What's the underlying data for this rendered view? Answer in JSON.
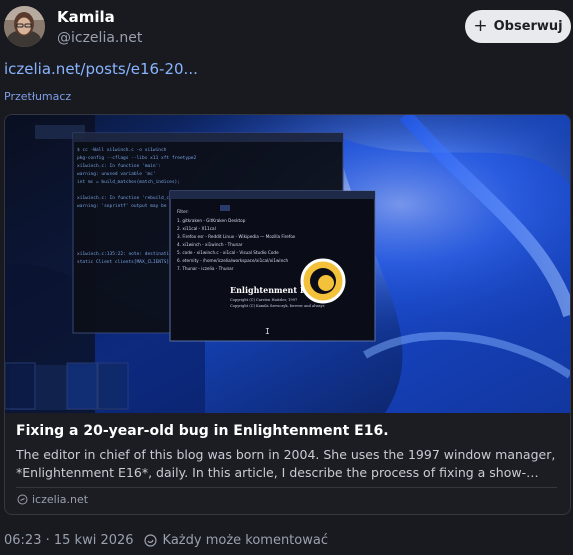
{
  "author": {
    "display_name": "Kamila",
    "handle": "@iczelia.net"
  },
  "actions": {
    "follow_label": "Obserwuj"
  },
  "post": {
    "link_text": "iczelia.net/posts/e16-20...",
    "translate_label": "Przetłumacz"
  },
  "link_card": {
    "title": "Fixing a 20-year-old bug in Enlightenment E16.",
    "description": "The editor in chief of this blog was born in 2004. She uses the 1997 window manager, *Enlightenment E16*, daily. In this article, I describe the process of fixing a show-…",
    "domain": "iczelia.net",
    "image": {
      "caption_title": "Enlightenment E16",
      "caption_lines": [
        "Copyright (C) Carsten Haitzler, 1997",
        "Copyright (C) Kamila Szewczyk, forever and always"
      ],
      "menu_items": [
        "1. gitkraken - GitKraken Desktop",
        "2. xi11cal - X11cal",
        "3. Firefox esr - Reddit Linux - Wikipedia — Mozilla Firefox",
        "4. xi1winch - xi1winch - Thunar",
        "5. code - xi1winch.c - xi1cal - Visual Studio Code",
        "6. eternity - /home/iczelia/workspace/xi1cal/xi1winch",
        "7. Thunar - iczelia - Thunar"
      ]
    }
  },
  "meta": {
    "timestamp": "06:23 · 15 kwi 2026",
    "reply_policy": "Każdy może komentować"
  },
  "colors": {
    "background": "#181a20",
    "link": "#8ab4ff",
    "button_bg": "#e9eaee"
  }
}
